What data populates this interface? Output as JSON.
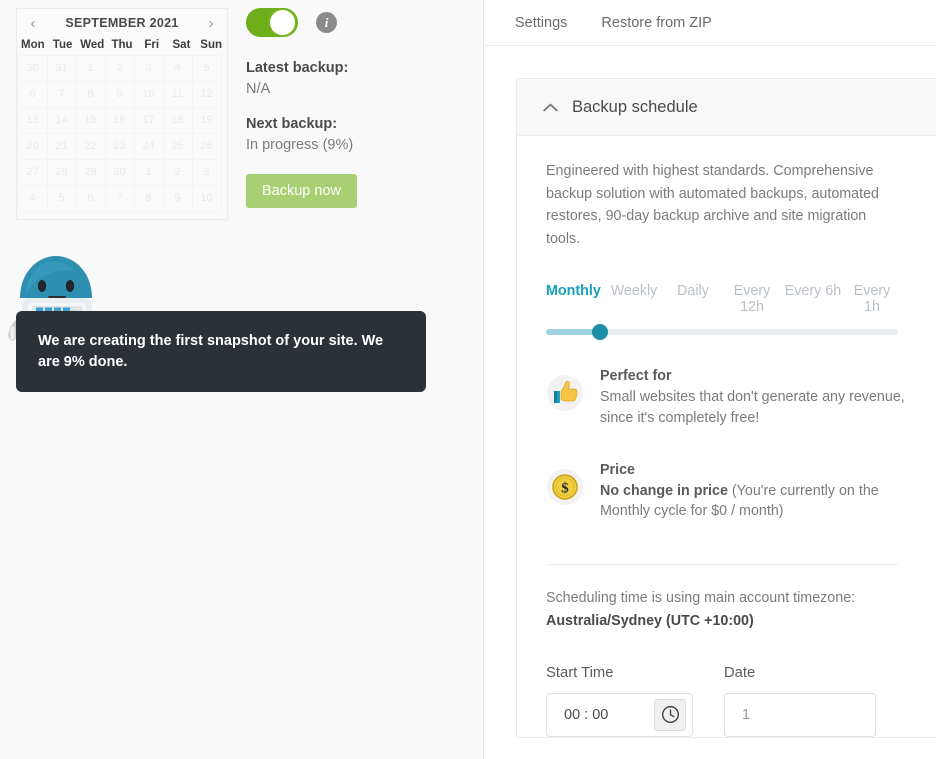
{
  "calendar": {
    "prev_label": "‹",
    "next_label": "›",
    "title": "SEPTEMBER 2021",
    "weekdays": [
      "Mon",
      "Tue",
      "Wed",
      "Thu",
      "Fri",
      "Sat",
      "Sun"
    ],
    "days": [
      "30",
      "31",
      "1",
      "2",
      "3",
      "4",
      "5",
      "6",
      "7",
      "8",
      "9",
      "10",
      "11",
      "12",
      "13",
      "14",
      "15",
      "16",
      "17",
      "18",
      "19",
      "20",
      "21",
      "22",
      "23",
      "24",
      "25",
      "26",
      "27",
      "28",
      "29",
      "30",
      "1",
      "2",
      "3",
      "4",
      "5",
      "6",
      "7",
      "8",
      "9",
      "10"
    ]
  },
  "toggle": {
    "state": "on"
  },
  "info_icon": {
    "glyph": "i"
  },
  "backup_info": {
    "latest_label": "Latest backup:",
    "latest_value": "N/A",
    "next_label": "Next backup:",
    "next_value": "In progress (9%)",
    "backup_now_label": "Backup now"
  },
  "mascot_tooltip": {
    "text": "We are creating the first snapshot of your site. We are 9% done."
  },
  "tabs": [
    {
      "label": "Settings"
    },
    {
      "label": "Restore from ZIP"
    }
  ],
  "card": {
    "title": "Backup schedule",
    "collapse_icon": "∧",
    "description": "Engineered with highest standards. Comprehensive backup solution with automated backups, automated restores, 90-day backup archive and site migration tools."
  },
  "frequency": {
    "options": [
      "Monthly",
      "Weekly",
      "Daily",
      "Every 12h",
      "Every 6h",
      "Every 1h"
    ],
    "selected": "Monthly",
    "slider_percent": 9
  },
  "features": [
    {
      "icon": "thumbs-up-icon",
      "title": "Perfect for",
      "text": "Small websites that don't generate any revenue, since it's completely free!"
    },
    {
      "icon": "dollar-coin-icon",
      "title": "Price",
      "text_bold": "No change in price",
      "text_rest": " (You're currently on the Monthly cycle for $0 / month)"
    }
  ],
  "timezone": {
    "line1": "Scheduling time is using main account timezone:",
    "line2": "Australia/Sydney (UTC +10:00)"
  },
  "fields": {
    "start_time_label": "Start Time",
    "start_time_value": "00 : 00",
    "date_label": "Date",
    "date_value": "1"
  },
  "colors": {
    "accent_teal": "#17a2b8",
    "toggle_green": "#6fae1b",
    "button_green": "#a8cf72",
    "tooltip_bg": "#2b3137"
  }
}
